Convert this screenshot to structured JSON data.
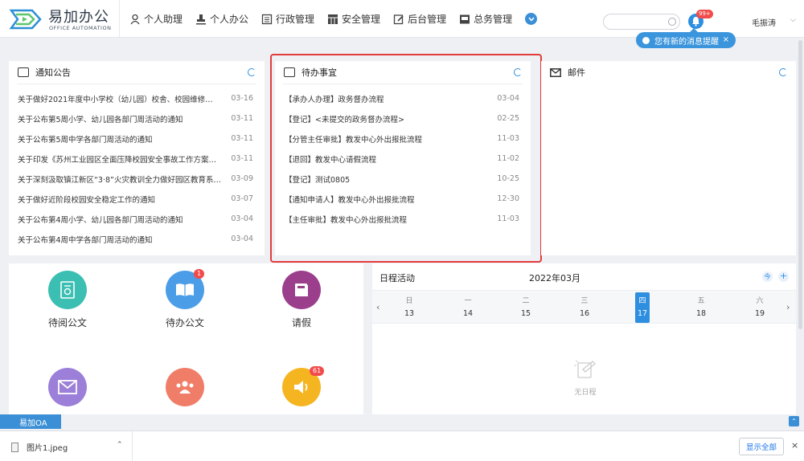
{
  "brand": {
    "title": "易加办公",
    "subtitle": "OFFICE AUTOMATION"
  },
  "nav": [
    {
      "label": "个人助理",
      "icon": "person-icon"
    },
    {
      "label": "个人办公",
      "icon": "stamp-icon"
    },
    {
      "label": "行政管理",
      "icon": "document-icon"
    },
    {
      "label": "安全管理",
      "icon": "grid-icon"
    },
    {
      "label": "后台管理",
      "icon": "edit-icon"
    },
    {
      "label": "总务管理",
      "icon": "monitor-icon"
    }
  ],
  "header": {
    "search_placeholder": "",
    "bell_badge": "99+",
    "user_name": "毛振涛",
    "user_caret": "⌵",
    "toast_text": "您有新的消息提醒",
    "toast_close": "×"
  },
  "notices": {
    "title": "通知公告",
    "items": [
      {
        "title": "关于做好2021年度中小学校（幼儿园）校舍、校园维修…",
        "date": "03-16"
      },
      {
        "title": "关于公布第5周小学、幼儿园各部门周活动的通知",
        "date": "03-11"
      },
      {
        "title": "关于公布第5周中学各部门周活动的通知",
        "date": "03-11"
      },
      {
        "title": "关于印发《苏州工业园区全面压降校园安全事故工作方案…",
        "date": "03-11"
      },
      {
        "title": "关于深刻汲取镇江新区“3·8”火灾教训全力做好园区教育系…",
        "date": "03-09"
      },
      {
        "title": "关于做好近阶段校园安全稳定工作的通知",
        "date": "03-07"
      },
      {
        "title": "关于公布第4周小学、幼儿园各部门周活动的通知",
        "date": "03-04"
      },
      {
        "title": "关于公布第4周中学各部门周活动的通知",
        "date": "03-04"
      }
    ]
  },
  "todo": {
    "title": "待办事宜",
    "items": [
      {
        "title": "【承办人办理】政务督办流程",
        "date": "03-04"
      },
      {
        "title": "【登记】<未提交的政务督办流程>",
        "date": "02-25"
      },
      {
        "title": "【分管主任审批】教发中心外出报批流程",
        "date": "11-03"
      },
      {
        "title": "【退回】教发中心请假流程",
        "date": "11-02"
      },
      {
        "title": "【登记】测试0805",
        "date": "10-25"
      },
      {
        "title": "【通知申请人】教发中心外出报批流程",
        "date": "12-30"
      },
      {
        "title": "【主任审批】教发中心外出报批流程",
        "date": "11-03"
      }
    ]
  },
  "mail": {
    "title": "邮件"
  },
  "apps": [
    {
      "label": "待阅公文",
      "icon": "read-doc-icon",
      "color": "#3bbfb2",
      "badge": ""
    },
    {
      "label": "待办公文",
      "icon": "book-icon",
      "color": "#4a9de6",
      "badge": "1"
    },
    {
      "label": "请假",
      "icon": "leave-book-icon",
      "color": "#9b3f8d",
      "badge": ""
    },
    {
      "label": "",
      "icon": "mail-icon",
      "color": "#9b7fd8",
      "badge": ""
    },
    {
      "label": "",
      "icon": "people-icon",
      "color": "#f07d68",
      "badge": ""
    },
    {
      "label": "",
      "icon": "speaker-icon",
      "color": "#f5b520",
      "badge": "61"
    }
  ],
  "calendar": {
    "title": "日程活动",
    "month": "2022年03月",
    "today_label": "今",
    "add_label": "+",
    "prev": "‹",
    "next": "›",
    "days": [
      {
        "weekday": "日",
        "date": "13",
        "active": false
      },
      {
        "weekday": "一",
        "date": "14",
        "active": false
      },
      {
        "weekday": "二",
        "date": "15",
        "active": false
      },
      {
        "weekday": "三",
        "date": "16",
        "active": false
      },
      {
        "weekday": "四",
        "date": "17",
        "active": true
      },
      {
        "weekday": "五",
        "date": "18",
        "active": false
      },
      {
        "weekday": "六",
        "date": "19",
        "active": false
      }
    ],
    "empty_text": "无日程"
  },
  "bottom": {
    "oa_tab": "易加OA",
    "up_arrow": "⌃",
    "download_file": "图片1.jpeg",
    "download_caret": "⌃",
    "show_all": "显示全部",
    "close": "×"
  },
  "colors": {
    "accent": "#2e8ee0",
    "highlight_border": "#e23b3b",
    "badge": "#f24b4b"
  }
}
